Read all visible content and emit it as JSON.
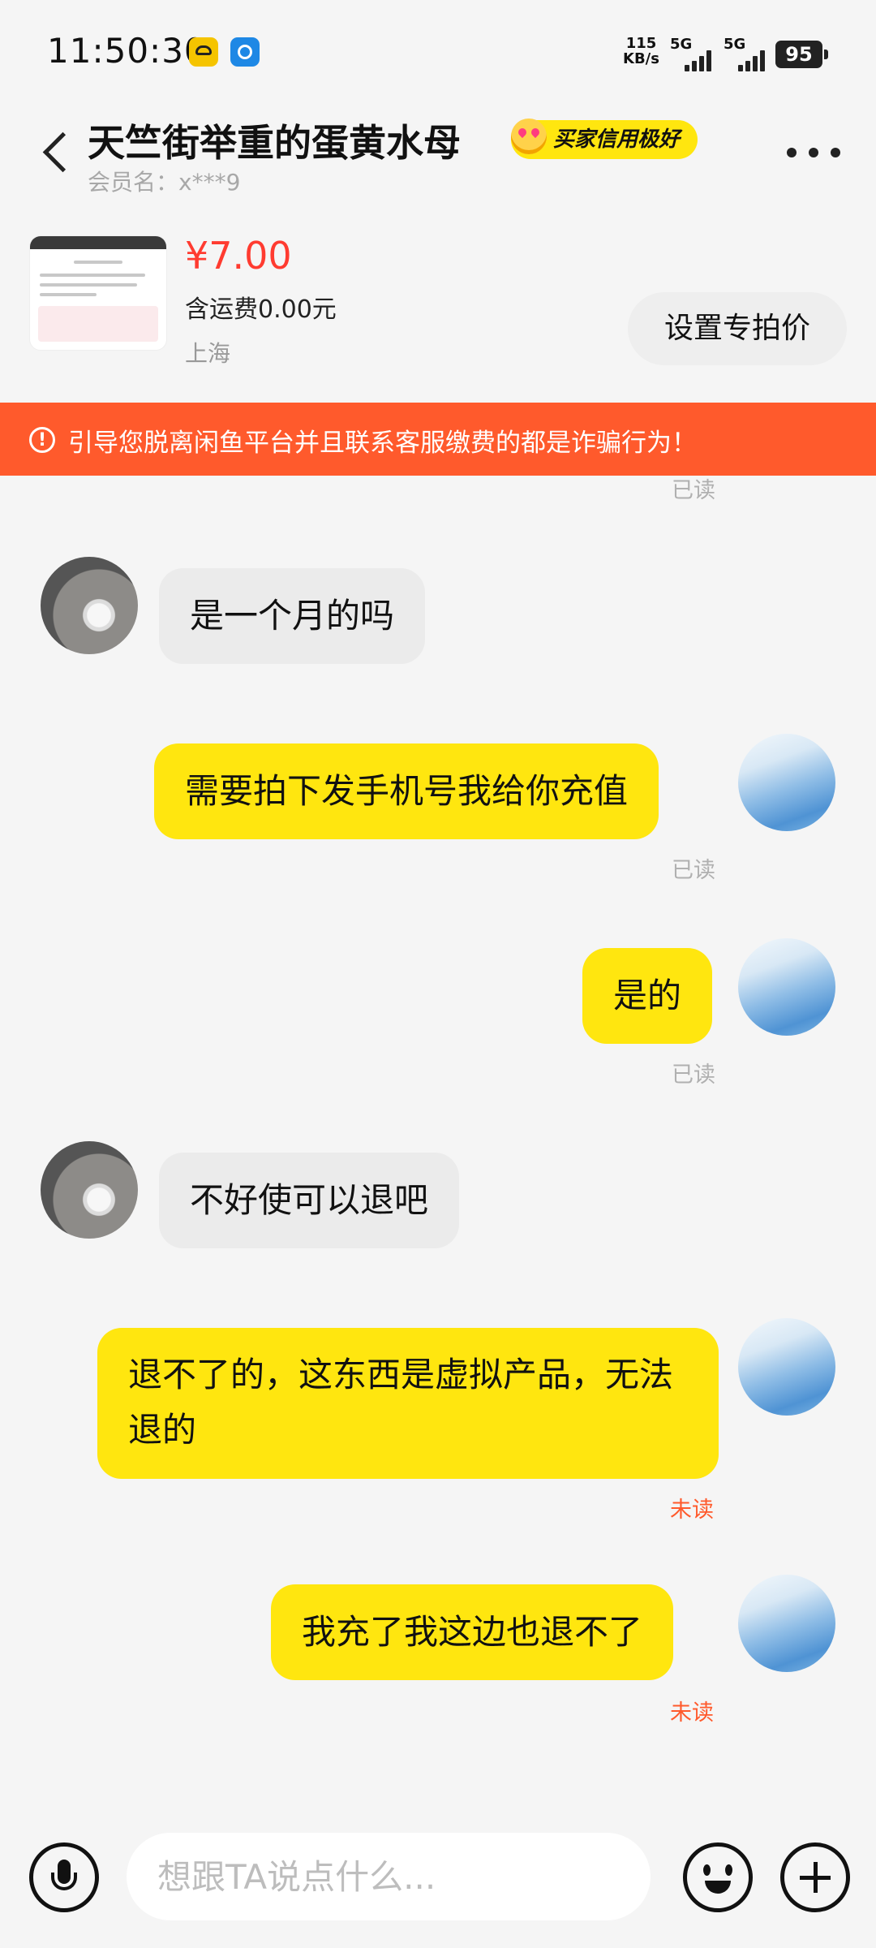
{
  "status_bar": {
    "time": "11:50:30",
    "net_speed_value": "115",
    "net_speed_unit": "KB/s",
    "sim1": "5G",
    "sim2": "5G",
    "battery": "95"
  },
  "header": {
    "title": "天竺街举重的蛋黄水母",
    "badge": "买家信用极好",
    "member": "会员名：x***9"
  },
  "product": {
    "price": "¥7.00",
    "shipping": "含运费0.00元",
    "location": "上海",
    "special_price_button": "设置专拍价"
  },
  "warning": {
    "icon": "!",
    "text": "引导您脱离闲鱼平台并且联系客服缴费的都是诈骗行为！"
  },
  "messages": [
    {
      "side": "status",
      "status": "已读"
    },
    {
      "side": "in",
      "text": "是一个月的吗"
    },
    {
      "side": "out",
      "text": "需要拍下发手机号我给你充值",
      "status": "已读"
    },
    {
      "side": "out",
      "text": "是的",
      "status": "已读"
    },
    {
      "side": "in",
      "text": "不好使可以退吧"
    },
    {
      "side": "out",
      "text": "退不了的，这东西是虚拟产品，无法退的",
      "status": "未读"
    },
    {
      "side": "out",
      "text": "我充了我这边也退不了",
      "status": "未读"
    }
  ],
  "input": {
    "placeholder": "想跟TA说点什么..."
  },
  "icons": {
    "back": "back-arrow-icon",
    "more": "more-dots-icon",
    "mic": "microphone-icon",
    "emoji": "emoji-icon",
    "plus": "plus-icon",
    "warning": "warning-icon"
  },
  "colors": {
    "accent_yellow": "#ffe60f",
    "warning_bar": "#ff5a2c",
    "price": "#ff3b30",
    "unread": "#ff5a2c"
  }
}
